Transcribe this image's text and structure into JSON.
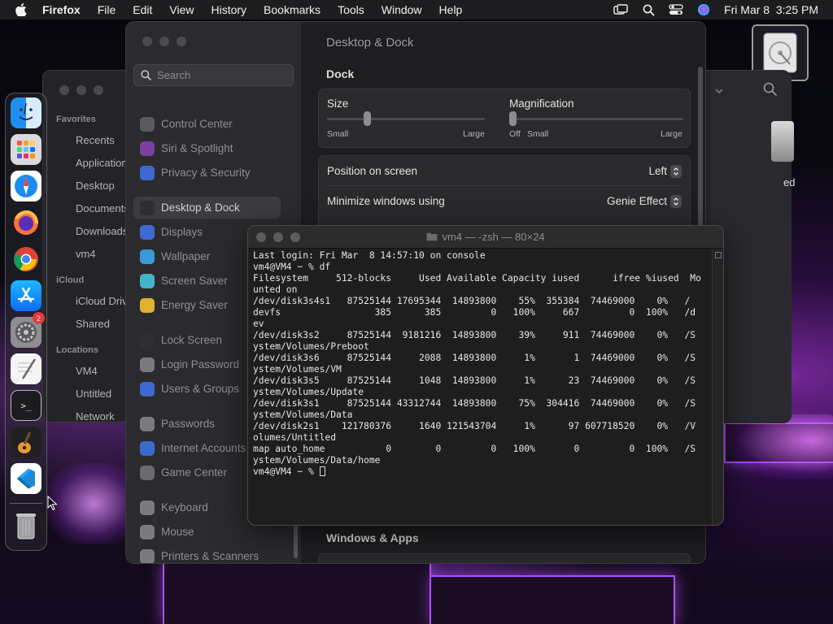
{
  "menubar": {
    "app": "Firefox",
    "items": [
      "File",
      "Edit",
      "View",
      "History",
      "Bookmarks",
      "Tools",
      "Window",
      "Help"
    ],
    "clock": "Fri Mar 8  3:25 PM"
  },
  "dock": {
    "items": [
      "finder",
      "launchpad",
      "safari",
      "firefox",
      "chrome",
      "app-store",
      "system-settings",
      "textedit",
      "terminal",
      "garageband",
      "vscode",
      "trash"
    ],
    "settings_badge": "2"
  },
  "desktop": {
    "finder_drive_label": "ed"
  },
  "finder": {
    "favorites_title": "Favorites",
    "favorites": [
      "Recents",
      "Applications",
      "Desktop",
      "Documents",
      "Downloads",
      "vm4"
    ],
    "icloud_title": "iCloud",
    "icloud": [
      "iCloud Drive",
      "Shared"
    ],
    "locations_title": "Locations",
    "locations": [
      "VM4",
      "Untitled",
      "Network"
    ]
  },
  "settings": {
    "search_placeholder": "Search",
    "nav": [
      {
        "label": "Control Center",
        "icon": "control-center-icon",
        "color": "#5a5a5f"
      },
      {
        "label": "Siri & Spotlight",
        "icon": "siri-icon",
        "color": "#7a3fa0"
      },
      {
        "label": "Privacy & Security",
        "icon": "hand-icon",
        "color": "#3c6ad0"
      },
      {
        "label": "Desktop & Dock",
        "icon": "dock-icon",
        "color": "#2f2f33"
      },
      {
        "label": "Displays",
        "icon": "sun-icon",
        "color": "#3c6ad0"
      },
      {
        "label": "Wallpaper",
        "icon": "flower-icon",
        "color": "#3a9ad8"
      },
      {
        "label": "Screen Saver",
        "icon": "screen-saver-icon",
        "color": "#44b4c8"
      },
      {
        "label": "Energy Saver",
        "icon": "bulb-icon",
        "color": "#e0b030"
      },
      {
        "label": "Lock Screen",
        "icon": "lock-icon",
        "color": "#2f2f33"
      },
      {
        "label": "Login Password",
        "icon": "key-icon",
        "color": "#7a7a7f"
      },
      {
        "label": "Users & Groups",
        "icon": "users-icon",
        "color": "#3c6ad0"
      },
      {
        "label": "Passwords",
        "icon": "password-key-icon",
        "color": "#7a7a7f"
      },
      {
        "label": "Internet Accounts",
        "icon": "at-icon",
        "color": "#3c6ad0"
      },
      {
        "label": "Game Center",
        "icon": "game-center-icon",
        "color": "#6a6a6f"
      },
      {
        "label": "Keyboard",
        "icon": "keyboard-icon",
        "color": "#7a7a7f"
      },
      {
        "label": "Mouse",
        "icon": "mouse-icon",
        "color": "#7a7a7f"
      },
      {
        "label": "Printers & Scanners",
        "icon": "printer-icon",
        "color": "#7a7a7f"
      }
    ],
    "page_title": "Desktop & Dock",
    "dock_heading": "Dock",
    "size": {
      "label": "Size",
      "min": "Small",
      "max": "Large",
      "value": 0.25
    },
    "magnification": {
      "label": "Magnification",
      "off": "Off",
      "min": "Small",
      "max": "Large",
      "value": 0.0
    },
    "position_label": "Position on screen",
    "position_value": "Left",
    "minimize_label": "Minimize windows using",
    "minimize_value": "Genie Effect",
    "windows_apps_heading": "Windows & Apps"
  },
  "terminal": {
    "title": "vm4 — -zsh — 80×24",
    "lines": [
      "Last login: Fri Mar  8 14:57:10 on console",
      "vm4@VM4 ~ % df",
      "Filesystem     512-blocks     Used Available Capacity iused      ifree %iused  Mo",
      "unted on",
      "/dev/disk3s4s1   87525144 17695344  14893800    55%  355384  74469000    0%   /",
      "devfs                 385      385         0   100%     667         0  100%   /d",
      "ev",
      "/dev/disk3s2     87525144  9181216  14893800    39%     911  74469000    0%   /S",
      "ystem/Volumes/Preboot",
      "/dev/disk3s6     87525144     2088  14893800     1%       1  74469000    0%   /S",
      "ystem/Volumes/VM",
      "/dev/disk3s5     87525144     1048  14893800     1%      23  74469000    0%   /S",
      "ystem/Volumes/Update",
      "/dev/disk3s1     87525144 43312744  14893800    75%  304416  74469000    0%   /S",
      "ystem/Volumes/Data",
      "/dev/disk2s1    121780376     1640 121543704     1%      97 607718520    0%   /V",
      "olumes/Untitled",
      "map auto_home           0        0         0   100%       0         0  100%   /S",
      "ystem/Volumes/Data/home"
    ],
    "prompt": "vm4@VM4 ~ % "
  }
}
